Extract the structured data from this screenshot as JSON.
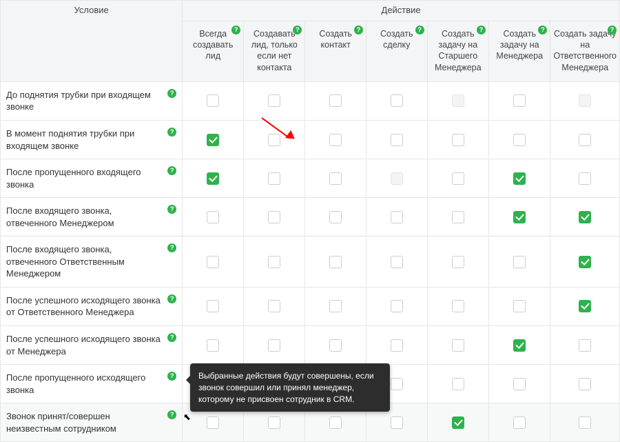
{
  "headers": {
    "condition": "Условие",
    "action_group": "Действие",
    "columns": [
      "Всегда создавать лид",
      "Создавать лид, только если нет контакта",
      "Создать контакт",
      "Создать сделку",
      "Создать задачу на Старшего Менеджера",
      "Создать задачу на Менеджера",
      "Создать задачу на Ответственного Менеджера"
    ]
  },
  "rows": [
    {
      "label": "До поднятия трубки при входящем звонке",
      "cells": [
        "off",
        "off",
        "off",
        "off",
        "disabled",
        "off",
        "disabled"
      ]
    },
    {
      "label": "В момент поднятия трубки при входящем звонке",
      "cells": [
        "on",
        "off",
        "off",
        "off",
        "off",
        "off",
        "off"
      ]
    },
    {
      "label": "После пропущенного входящего звонка",
      "cells": [
        "on",
        "off",
        "off",
        "disabled",
        "off",
        "on",
        "off"
      ]
    },
    {
      "label": "После входящего звонка, отвеченного Менеджером",
      "cells": [
        "off",
        "off",
        "off",
        "off",
        "off",
        "on",
        "on"
      ]
    },
    {
      "label": "После входящего звонка, отвеченного Ответственным Менеджером",
      "cells": [
        "off",
        "off",
        "off",
        "off",
        "off",
        "off",
        "on"
      ]
    },
    {
      "label": "После успешного исходящего звонка от Ответственного Менеджера",
      "cells": [
        "off",
        "off",
        "off",
        "off",
        "off",
        "off",
        "on"
      ]
    },
    {
      "label": "После успешного исходящего звонка от Менеджера",
      "cells": [
        "off",
        "off",
        "off",
        "off",
        "off",
        "on",
        "off"
      ]
    },
    {
      "label": "После пропущенного исходящего звонка",
      "cells": [
        "off",
        "off",
        "off",
        "off",
        "off",
        "off",
        "off"
      ]
    },
    {
      "label": "Звонок принят/совершен неизвестным сотрудником",
      "cells": [
        "off",
        "off",
        "off",
        "off",
        "on",
        "off",
        "off"
      ],
      "highlight": true
    }
  ],
  "tooltip": "Выбранные действия будут совершены, если звонок совершил или принял менеджер, которому не присвоен сотрудник в CRM.",
  "annotation_arrow": {
    "target_row": 1,
    "target_col": 0,
    "description": "red arrow pointing at checked box in row 2 col 1"
  }
}
